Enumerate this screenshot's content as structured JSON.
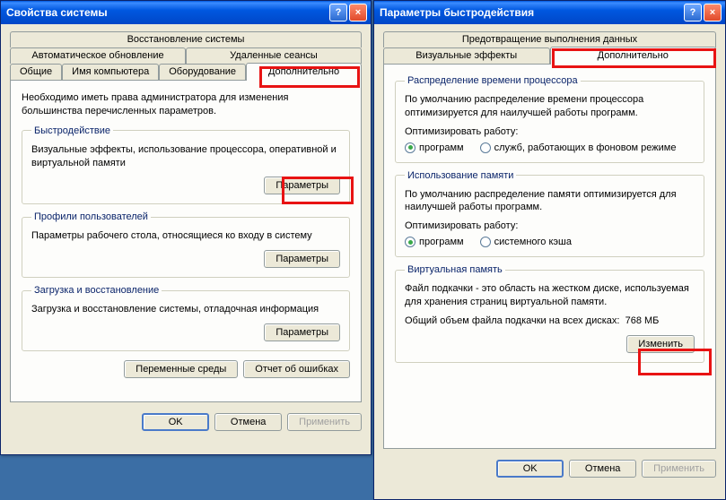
{
  "win1": {
    "title": "Свойства системы",
    "tabs_row1": [
      "Восстановление системы"
    ],
    "tabs_row2": [
      "Автоматическое обновление",
      "Удаленные сеансы"
    ],
    "tabs_row3": [
      "Общие",
      "Имя компьютера",
      "Оборудование",
      "Дополнительно"
    ],
    "intro": "Необходимо иметь права администратора для изменения большинства перечисленных параметров.",
    "perf": {
      "legend": "Быстродействие",
      "desc": "Визуальные эффекты, использование процессора, оперативной и виртуальной памяти",
      "params": "Параметры"
    },
    "profiles": {
      "legend": "Профили пользователей",
      "desc": "Параметры рабочего стола, относящиеся ко входу в систему",
      "params": "Параметры"
    },
    "startup": {
      "legend": "Загрузка и восстановление",
      "desc": "Загрузка и восстановление системы, отладочная информация",
      "params": "Параметры"
    },
    "envvars": "Переменные среды",
    "errreport": "Отчет об ошибках",
    "ok": "OK",
    "cancel": "Отмена",
    "apply": "Применить"
  },
  "win2": {
    "title": "Параметры быстродействия",
    "tabs_row1": [
      "Предотвращение выполнения данных"
    ],
    "tabs_row2": [
      "Визуальные эффекты",
      "Дополнительно"
    ],
    "cpu": {
      "legend": "Распределение времени процессора",
      "desc": "По умолчанию распределение времени процессора оптимизируется для наилучшей работы программ.",
      "optimize": "Оптимизировать работу:",
      "opt_programs": "программ",
      "opt_services": "служб, работающих в фоновом режиме"
    },
    "mem": {
      "legend": "Использование памяти",
      "desc": "По умолчанию распределение памяти оптимизируется для наилучшей работы программ.",
      "optimize": "Оптимизировать работу:",
      "opt_programs": "программ",
      "opt_cache": "системного кэша"
    },
    "vmem": {
      "legend": "Виртуальная память",
      "desc": "Файл подкачки - это область на жестком диске, используемая для хранения страниц виртуальной памяти.",
      "total_label": "Общий объем файла подкачки на всех дисках:",
      "total_value": "768 МБ",
      "change": "Изменить"
    },
    "ok": "OK",
    "cancel": "Отмена",
    "apply": "Применить"
  }
}
